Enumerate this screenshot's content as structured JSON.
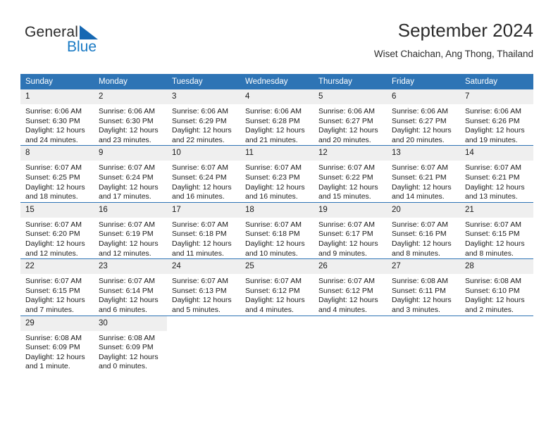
{
  "brand": {
    "name_top": "General",
    "name_bottom": "Blue",
    "accent_color": "#1879c4",
    "triangle_color": "#1668b3"
  },
  "header": {
    "title": "September 2024",
    "subtitle": "Wiset Chaichan, Ang Thong, Thailand"
  },
  "calendar": {
    "header_color": "#2e74b5",
    "daynum_background": "#efefef",
    "weekday_names": [
      "Sunday",
      "Monday",
      "Tuesday",
      "Wednesday",
      "Thursday",
      "Friday",
      "Saturday"
    ],
    "weeks": [
      [
        {
          "day": "1",
          "sunrise": "Sunrise: 6:06 AM",
          "sunset": "Sunset: 6:30 PM",
          "daylight_line1": "Daylight: 12 hours",
          "daylight_line2": "and 24 minutes."
        },
        {
          "day": "2",
          "sunrise": "Sunrise: 6:06 AM",
          "sunset": "Sunset: 6:30 PM",
          "daylight_line1": "Daylight: 12 hours",
          "daylight_line2": "and 23 minutes."
        },
        {
          "day": "3",
          "sunrise": "Sunrise: 6:06 AM",
          "sunset": "Sunset: 6:29 PM",
          "daylight_line1": "Daylight: 12 hours",
          "daylight_line2": "and 22 minutes."
        },
        {
          "day": "4",
          "sunrise": "Sunrise: 6:06 AM",
          "sunset": "Sunset: 6:28 PM",
          "daylight_line1": "Daylight: 12 hours",
          "daylight_line2": "and 21 minutes."
        },
        {
          "day": "5",
          "sunrise": "Sunrise: 6:06 AM",
          "sunset": "Sunset: 6:27 PM",
          "daylight_line1": "Daylight: 12 hours",
          "daylight_line2": "and 20 minutes."
        },
        {
          "day": "6",
          "sunrise": "Sunrise: 6:06 AM",
          "sunset": "Sunset: 6:27 PM",
          "daylight_line1": "Daylight: 12 hours",
          "daylight_line2": "and 20 minutes."
        },
        {
          "day": "7",
          "sunrise": "Sunrise: 6:06 AM",
          "sunset": "Sunset: 6:26 PM",
          "daylight_line1": "Daylight: 12 hours",
          "daylight_line2": "and 19 minutes."
        }
      ],
      [
        {
          "day": "8",
          "sunrise": "Sunrise: 6:07 AM",
          "sunset": "Sunset: 6:25 PM",
          "daylight_line1": "Daylight: 12 hours",
          "daylight_line2": "and 18 minutes."
        },
        {
          "day": "9",
          "sunrise": "Sunrise: 6:07 AM",
          "sunset": "Sunset: 6:24 PM",
          "daylight_line1": "Daylight: 12 hours",
          "daylight_line2": "and 17 minutes."
        },
        {
          "day": "10",
          "sunrise": "Sunrise: 6:07 AM",
          "sunset": "Sunset: 6:24 PM",
          "daylight_line1": "Daylight: 12 hours",
          "daylight_line2": "and 16 minutes."
        },
        {
          "day": "11",
          "sunrise": "Sunrise: 6:07 AM",
          "sunset": "Sunset: 6:23 PM",
          "daylight_line1": "Daylight: 12 hours",
          "daylight_line2": "and 16 minutes."
        },
        {
          "day": "12",
          "sunrise": "Sunrise: 6:07 AM",
          "sunset": "Sunset: 6:22 PM",
          "daylight_line1": "Daylight: 12 hours",
          "daylight_line2": "and 15 minutes."
        },
        {
          "day": "13",
          "sunrise": "Sunrise: 6:07 AM",
          "sunset": "Sunset: 6:21 PM",
          "daylight_line1": "Daylight: 12 hours",
          "daylight_line2": "and 14 minutes."
        },
        {
          "day": "14",
          "sunrise": "Sunrise: 6:07 AM",
          "sunset": "Sunset: 6:21 PM",
          "daylight_line1": "Daylight: 12 hours",
          "daylight_line2": "and 13 minutes."
        }
      ],
      [
        {
          "day": "15",
          "sunrise": "Sunrise: 6:07 AM",
          "sunset": "Sunset: 6:20 PM",
          "daylight_line1": "Daylight: 12 hours",
          "daylight_line2": "and 12 minutes."
        },
        {
          "day": "16",
          "sunrise": "Sunrise: 6:07 AM",
          "sunset": "Sunset: 6:19 PM",
          "daylight_line1": "Daylight: 12 hours",
          "daylight_line2": "and 12 minutes."
        },
        {
          "day": "17",
          "sunrise": "Sunrise: 6:07 AM",
          "sunset": "Sunset: 6:18 PM",
          "daylight_line1": "Daylight: 12 hours",
          "daylight_line2": "and 11 minutes."
        },
        {
          "day": "18",
          "sunrise": "Sunrise: 6:07 AM",
          "sunset": "Sunset: 6:18 PM",
          "daylight_line1": "Daylight: 12 hours",
          "daylight_line2": "and 10 minutes."
        },
        {
          "day": "19",
          "sunrise": "Sunrise: 6:07 AM",
          "sunset": "Sunset: 6:17 PM",
          "daylight_line1": "Daylight: 12 hours",
          "daylight_line2": "and 9 minutes."
        },
        {
          "day": "20",
          "sunrise": "Sunrise: 6:07 AM",
          "sunset": "Sunset: 6:16 PM",
          "daylight_line1": "Daylight: 12 hours",
          "daylight_line2": "and 8 minutes."
        },
        {
          "day": "21",
          "sunrise": "Sunrise: 6:07 AM",
          "sunset": "Sunset: 6:15 PM",
          "daylight_line1": "Daylight: 12 hours",
          "daylight_line2": "and 8 minutes."
        }
      ],
      [
        {
          "day": "22",
          "sunrise": "Sunrise: 6:07 AM",
          "sunset": "Sunset: 6:15 PM",
          "daylight_line1": "Daylight: 12 hours",
          "daylight_line2": "and 7 minutes."
        },
        {
          "day": "23",
          "sunrise": "Sunrise: 6:07 AM",
          "sunset": "Sunset: 6:14 PM",
          "daylight_line1": "Daylight: 12 hours",
          "daylight_line2": "and 6 minutes."
        },
        {
          "day": "24",
          "sunrise": "Sunrise: 6:07 AM",
          "sunset": "Sunset: 6:13 PM",
          "daylight_line1": "Daylight: 12 hours",
          "daylight_line2": "and 5 minutes."
        },
        {
          "day": "25",
          "sunrise": "Sunrise: 6:07 AM",
          "sunset": "Sunset: 6:12 PM",
          "daylight_line1": "Daylight: 12 hours",
          "daylight_line2": "and 4 minutes."
        },
        {
          "day": "26",
          "sunrise": "Sunrise: 6:07 AM",
          "sunset": "Sunset: 6:12 PM",
          "daylight_line1": "Daylight: 12 hours",
          "daylight_line2": "and 4 minutes."
        },
        {
          "day": "27",
          "sunrise": "Sunrise: 6:08 AM",
          "sunset": "Sunset: 6:11 PM",
          "daylight_line1": "Daylight: 12 hours",
          "daylight_line2": "and 3 minutes."
        },
        {
          "day": "28",
          "sunrise": "Sunrise: 6:08 AM",
          "sunset": "Sunset: 6:10 PM",
          "daylight_line1": "Daylight: 12 hours",
          "daylight_line2": "and 2 minutes."
        }
      ],
      [
        {
          "day": "29",
          "sunrise": "Sunrise: 6:08 AM",
          "sunset": "Sunset: 6:09 PM",
          "daylight_line1": "Daylight: 12 hours",
          "daylight_line2": "and 1 minute."
        },
        {
          "day": "30",
          "sunrise": "Sunrise: 6:08 AM",
          "sunset": "Sunset: 6:09 PM",
          "daylight_line1": "Daylight: 12 hours",
          "daylight_line2": "and 0 minutes."
        },
        {
          "day": "",
          "sunrise": "",
          "sunset": "",
          "daylight_line1": "",
          "daylight_line2": ""
        },
        {
          "day": "",
          "sunrise": "",
          "sunset": "",
          "daylight_line1": "",
          "daylight_line2": ""
        },
        {
          "day": "",
          "sunrise": "",
          "sunset": "",
          "daylight_line1": "",
          "daylight_line2": ""
        },
        {
          "day": "",
          "sunrise": "",
          "sunset": "",
          "daylight_line1": "",
          "daylight_line2": ""
        },
        {
          "day": "",
          "sunrise": "",
          "sunset": "",
          "daylight_line1": "",
          "daylight_line2": ""
        }
      ]
    ]
  }
}
